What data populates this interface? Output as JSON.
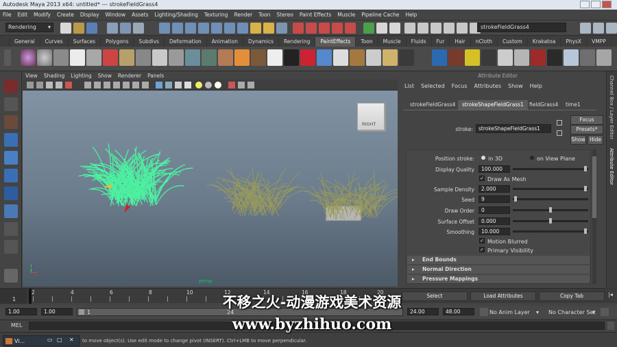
{
  "window": {
    "title": "Autodesk Maya 2013 x64: untitled*   ---   strokeFieldGrass4"
  },
  "menubar": [
    "File",
    "Edit",
    "Modify",
    "Create",
    "Display",
    "Window",
    "Assets",
    "Lighting/Shading",
    "Texturing",
    "Render",
    "Toon",
    "Stereo",
    "Paint Effects",
    "Muscle",
    "Pipeline Cache",
    "Help"
  ],
  "statusline": {
    "menu_set": "Rendering",
    "object_name": "strokeFieldGrass4"
  },
  "shelf_tabs": [
    "General",
    "Curves",
    "Surfaces",
    "Polygons",
    "Subdivs",
    "Deformation",
    "Animation",
    "Dynamics",
    "Rendering",
    "PaintEffects",
    "Toon",
    "Muscle",
    "Fluids",
    "Fur",
    "Hair",
    "nCloth",
    "Custom",
    "Krakatoa",
    "PhysX",
    "VMPP"
  ],
  "shelf_active": "PaintEffects",
  "viewport": {
    "menus": [
      "View",
      "Shading",
      "Lighting",
      "Show",
      "Renderer",
      "Panels"
    ],
    "viewcube_label": "RIGHT",
    "camera_label": "persp"
  },
  "attribute_editor": {
    "title": "Attribute Editor",
    "menus": [
      "List",
      "Selected",
      "Focus",
      "Attributes",
      "Show",
      "Help"
    ],
    "tabs": [
      "strokeFieldGrass4",
      "strokeShapeFieldGrass1",
      "fieldGrass4",
      "time1"
    ],
    "active_tab": "strokeShapeFieldGrass1",
    "stroke_label": "stroke:",
    "stroke_value": "strokeShapeFieldGrass1",
    "buttons": {
      "focus": "Focus",
      "presets": "Presets*",
      "show": "Show",
      "hide": "Hide"
    },
    "fields": {
      "position_stroke": {
        "label": "Position stroke:",
        "opt1": "in 3D",
        "opt2": "on View Plane"
      },
      "display_quality": {
        "label": "Display Quality",
        "value": "100.000"
      },
      "draw_as_mesh": "Draw As Mesh",
      "sample_density": {
        "label": "Sample Density",
        "value": "2.000"
      },
      "seed": {
        "label": "Seed",
        "value": "9"
      },
      "draw_order": {
        "label": "Draw Order",
        "value": "0"
      },
      "surface_offset": {
        "label": "Surface Offset",
        "value": "0.000"
      },
      "smoothing": {
        "label": "Smoothing",
        "value": "10.000"
      },
      "motion_blurred": "Motion Blurred",
      "primary_visibility": "Primary Visibility"
    },
    "sections": [
      "End Bounds",
      "Normal Direction",
      "Pressure Mappings"
    ],
    "bottom_buttons": {
      "select": "Select",
      "load": "Load Attributes",
      "copy": "Copy Tab"
    }
  },
  "side_tabs": {
    "channel_box": "Channel Box / Layer Editor",
    "attribute_editor": "Attribute Editor"
  },
  "timeline": {
    "ticks": [
      "2",
      "4",
      "6",
      "8",
      "10",
      "12",
      "14",
      "16",
      "18",
      "20"
    ],
    "current": "1"
  },
  "range": {
    "start": "1.00",
    "start2": "1.00",
    "frame": "1",
    "end_frame": "24",
    "end": "24.00",
    "end2": "48.00",
    "anim_layer": "No Anim Layer",
    "char_set": "No Character Set"
  },
  "command_line": {
    "label": "MEL"
  },
  "help_line": {
    "text": "to move object(s). Use edit mode to change pivot (INSERT).  Ctrl+LMB to move perpendicular.",
    "task_label": "Vi..."
  },
  "watermark": {
    "line1": "不移之火-动漫游戏美术资源",
    "line2": "www.byzhihuo.com"
  },
  "colors": {
    "grass_selected": "#4cf0a0",
    "grass_dry": "#9a9a5a",
    "accent_active": "#5c5c5c"
  }
}
